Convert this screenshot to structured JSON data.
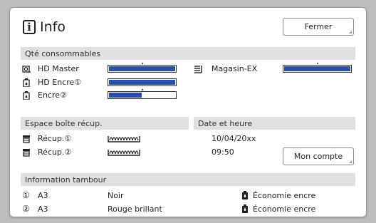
{
  "window": {
    "title": "Info",
    "close_button": "Fermer"
  },
  "consumables": {
    "header": "Qté consommables",
    "items": [
      {
        "label": "HD Master",
        "level": 1.0
      },
      {
        "label": "HD Encre①",
        "level": 1.0
      },
      {
        "label": "Encre②",
        "level": 0.5
      }
    ],
    "magazine": {
      "label": "Magasin-EX",
      "level": 1.0
    }
  },
  "disposal": {
    "header": "Espace boîte récup.",
    "items": [
      {
        "label": "Récup.①"
      },
      {
        "label": "Récup.②"
      }
    ]
  },
  "datetime": {
    "header": "Date et heure",
    "date": "10/04/20xx",
    "time": "09:50",
    "account_button": "Mon compte"
  },
  "drums": {
    "header": "Information tambour",
    "rows": [
      {
        "num": "①",
        "size": "A3",
        "color": "Noir",
        "mode": "Économie encre"
      },
      {
        "num": "②",
        "size": "A3",
        "color": "Rouge brillant",
        "mode": "Économie encre"
      }
    ]
  },
  "colors": {
    "bar_fill": "#2e4fa8",
    "section_bg": "#e0e0e0",
    "backdrop": "#bdbdbd"
  }
}
